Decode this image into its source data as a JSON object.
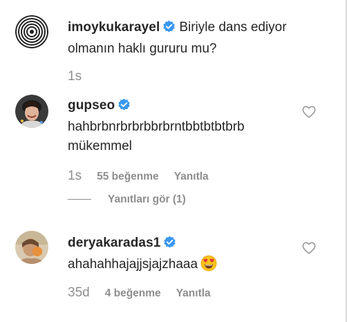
{
  "comments": [
    {
      "username": "imoykukarayel",
      "text": "Biriyle dans ediyor olmanın haklı gururu mu?",
      "time": "1s",
      "verified": true,
      "avatar_icon": "spiral-avatar"
    },
    {
      "username": "gupseo",
      "text": "hahbrbnrbrbrbbrbrntbbtbtbtbrb mükemmel",
      "time": "1s",
      "likes": "55 beğenme",
      "reply_label": "Yanıtla",
      "verified": true,
      "avatar_icon": "user-photo-avatar"
    },
    {
      "username": "deryakaradas1",
      "text": "ahahahhajajjsjajzhaaa",
      "emoji": "heart-eyes-emoji",
      "time": "35d",
      "likes": "4 beğenme",
      "reply_label": "Yanıtla",
      "verified": true,
      "avatar_icon": "user-photo-avatar"
    }
  ],
  "view_replies": "Yanıtları gör (1)",
  "colors": {
    "text": "#262626",
    "muted": "#8e8e8e",
    "verified_blue": "#3897f0",
    "border": "#dbdbdb"
  }
}
